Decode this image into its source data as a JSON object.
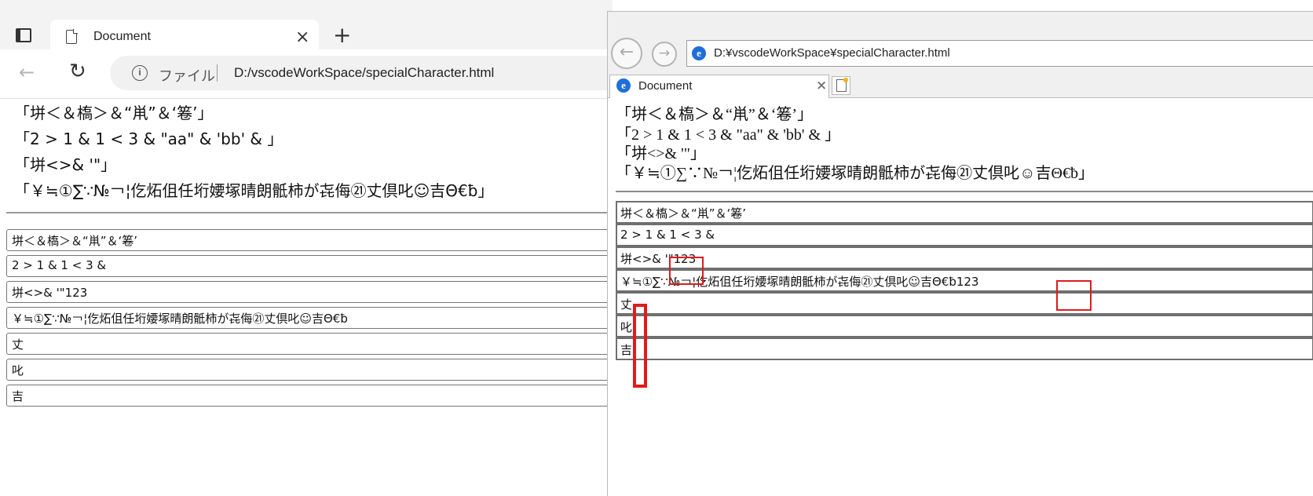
{
  "edge": {
    "tab_title": "Document",
    "tab_close": "×",
    "new_tab": "+",
    "back": "←",
    "reload": "↻",
    "info": "i",
    "file_label": "ファイル",
    "url": "D:/vscodeWorkSpace/specialCharacter.html",
    "lines": [
      "「垪＜＆槗＞＆“鼡”＆‘箞’」",
      "「2 > 1 & 1 < 3 & \"aa\" & 'bb' & 」",
      "「垪<>& '\"」",
      "「￥≒①∑∵№￢¦仡炻伹任垳婹塚晴朗骶柿が㐂侮㉑丈倶叱☺吉Θ€ƀ」"
    ],
    "inputs": [
      "垪＜＆槗＞＆“鼡”＆‘箞’",
      "2 > 1 & 1 < 3 &",
      "垪<>& '\"123",
      "￥≒①∑∵№￢¦仡炻伹任垳婹塚晴朗骶柿が㐂侮㉑丈倶叱☺吉Θ€ƀ",
      "丈",
      "叱",
      "吉"
    ]
  },
  "ie": {
    "back": "←",
    "forward": "→",
    "icon_letter": "e",
    "url": "D:¥vscodeWorkSpace¥specialCharacter.html",
    "tab_title": "Document",
    "tab_close": "×",
    "lines": [
      "「垪＜＆槗＞＆“鼡”＆‘箞’」",
      "「2 > 1 & 1 < 3 & \"aa\" & 'bb' & 」",
      "「垪<>& '\"」",
      "「￥≒①∑∵№￢¦仡炻伹任垳婹塚晴朗骶柿が㐂侮㉑丈倶叱☺吉Θ€ƀ」"
    ],
    "inputs": [
      "垪＜＆槗＞＆“鼡”＆‘箞’",
      "2 > 1 & 1 < 3 &",
      "垪<>& '\"123",
      "￥≒①∑∵№￢¦仡炻伹任垳婹塚晴朗骶柿が㐂侮㉑丈倶叱☺吉Θ€ƀ123",
      "丈",
      "叱",
      "吉"
    ]
  },
  "colors": {
    "highlight": "#e01b1b",
    "ie_icon": "#1e6fd9"
  }
}
